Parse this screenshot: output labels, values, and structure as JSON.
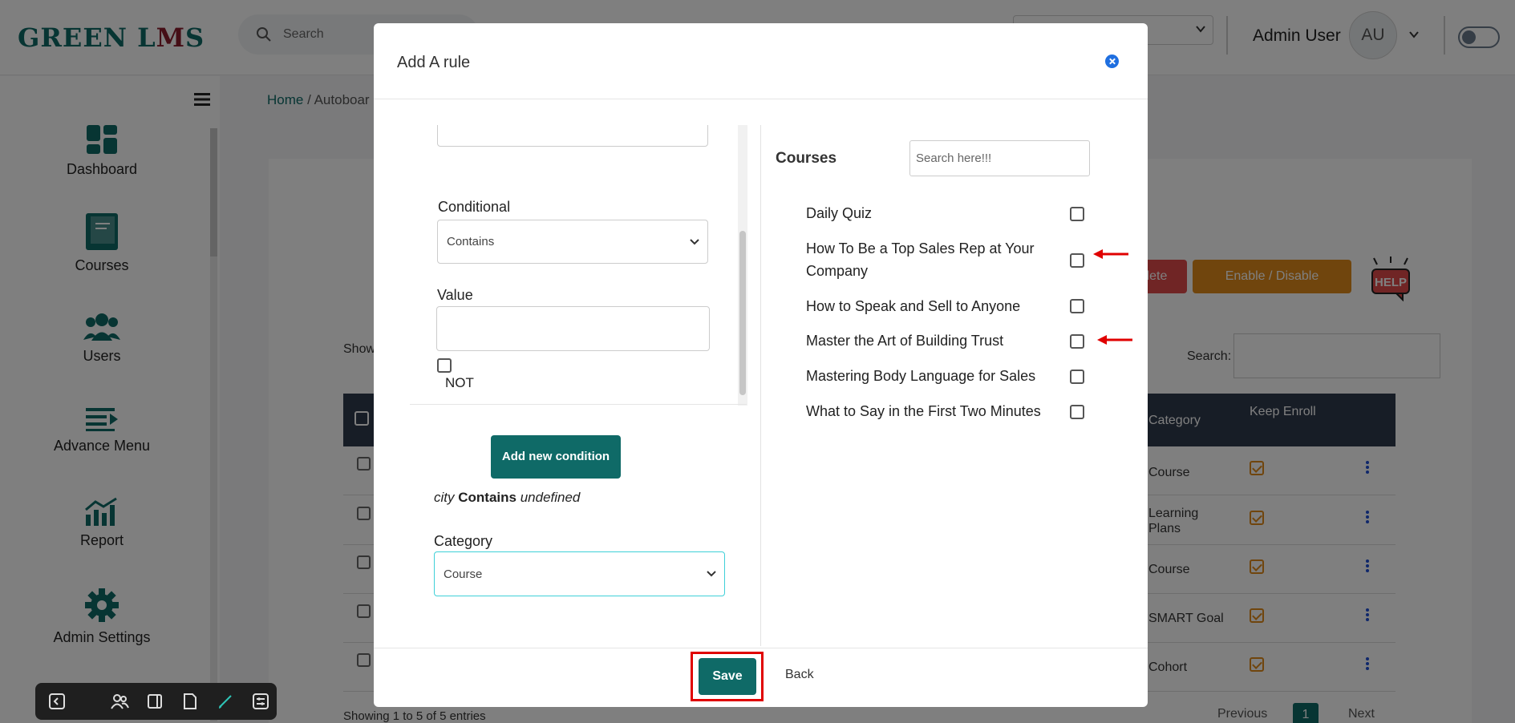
{
  "app": {
    "logo_a": "GREEN L",
    "logo_b": "M",
    "logo_c": "S",
    "search_placeholder": "Search",
    "user_name": "Admin User",
    "avatar_initials": "AU"
  },
  "breadcrumb": {
    "home": "Home",
    "sep": " / ",
    "current": "Autoboar"
  },
  "sidebar": {
    "items": [
      {
        "label": "Dashboard",
        "icon": "dashboard-icon"
      },
      {
        "label": "Courses",
        "icon": "book-icon"
      },
      {
        "label": "Users",
        "icon": "users-icon"
      },
      {
        "label": "Advance Menu",
        "icon": "menu-arrow-icon"
      },
      {
        "label": "Report",
        "icon": "chart-icon"
      },
      {
        "label": "Admin Settings",
        "icon": "gear-icon"
      }
    ]
  },
  "background": {
    "delete_label": "lete",
    "enable_label": "Enable / Disable",
    "help_label": "HELP",
    "show_label": "Show",
    "search_label": "Search:",
    "col_category": "Category",
    "col_keep_enroll": "Keep Enroll",
    "rows": [
      {
        "category": "Course"
      },
      {
        "category": "Learning Plans"
      },
      {
        "category": "Course"
      },
      {
        "category": "SMART Goal"
      },
      {
        "category": "Cohort"
      }
    ],
    "showing": "Showing 1 to 5 of 5 entries",
    "prev": "Previous",
    "page": "1",
    "next": "Next"
  },
  "modal": {
    "title": "Add A rule",
    "conditional_label": "Conditional",
    "conditional_value": "Contains",
    "value_label": "Value",
    "value_input": "",
    "not_label": "NOT",
    "add_condition": "Add new condition",
    "condition_field": "city",
    "condition_op": "Contains",
    "condition_val": "undefined",
    "category_label": "Category",
    "category_value": "Course",
    "courses_title": "Courses",
    "courses_search_placeholder": "Search here!!!",
    "courses": [
      {
        "name": "Daily Quiz",
        "checked": false
      },
      {
        "name": "How To Be a Top Sales Rep at Your Company",
        "checked": false
      },
      {
        "name": "How to Speak and Sell to Anyone",
        "checked": false
      },
      {
        "name": "Master the Art of Building Trust",
        "checked": false
      },
      {
        "name": "Mastering Body Language for Sales",
        "checked": false
      },
      {
        "name": "What to Say in the First Two Minutes",
        "checked": false
      }
    ],
    "save": "Save",
    "back": "Back"
  },
  "colors": {
    "brand": "#0f6a67",
    "accent_red": "#e00000",
    "warning": "#e08a1a",
    "danger": "#e04a4a"
  }
}
